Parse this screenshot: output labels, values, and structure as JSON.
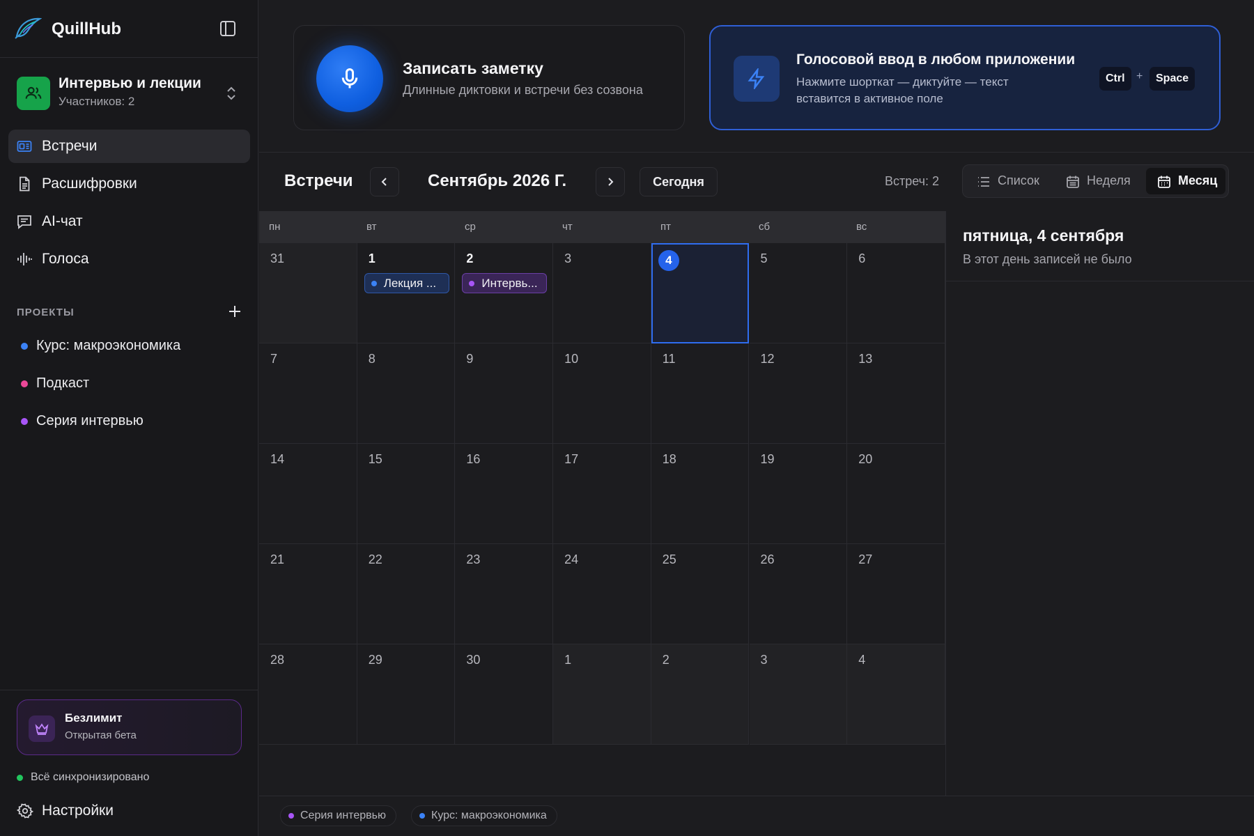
{
  "app": {
    "name": "QuillHub"
  },
  "workspace": {
    "name": "Интервью и лекции",
    "members": "Участников: 2"
  },
  "nav": [
    {
      "label": "Встречи",
      "icon": "meetings-icon",
      "active": true
    },
    {
      "label": "Расшифровки",
      "icon": "document-icon",
      "active": false
    },
    {
      "label": "AI-чат",
      "icon": "chat-icon",
      "active": false
    },
    {
      "label": "Голоса",
      "icon": "waveform-icon",
      "active": false
    }
  ],
  "projects": {
    "title": "ПРОЕКТЫ",
    "items": [
      {
        "label": "Курс: макроэкономика",
        "color": "#3b82f6"
      },
      {
        "label": "Подкаст",
        "color": "#ec4899"
      },
      {
        "label": "Серия интервью",
        "color": "#a855f7"
      }
    ]
  },
  "plan": {
    "title": "Безлимит",
    "subtitle": "Открытая бета"
  },
  "sync": {
    "label": "Всё синхронизировано",
    "color": "#22c55e"
  },
  "settings": {
    "label": "Настройки"
  },
  "record_card": {
    "title": "Записать заметку",
    "subtitle": "Длинные диктовки и встречи без созвона"
  },
  "voice_card": {
    "title": "Голосовой ввод в любом приложении",
    "subtitle": "Нажмите шорткат — диктуйте — текст вставится в активное поле",
    "keys": [
      "Ctrl",
      "Space"
    ],
    "plus": "+"
  },
  "toolbar": {
    "title": "Встречи",
    "month": "Сентябрь 2026 Г.",
    "today": "Сегодня",
    "count": "Встреч: 2",
    "views": [
      {
        "label": "Список",
        "icon": "list-icon",
        "active": false
      },
      {
        "label": "Неделя",
        "icon": "calendar-week-icon",
        "active": false
      },
      {
        "label": "Месяц",
        "icon": "calendar-month-icon",
        "active": true
      }
    ]
  },
  "calendar": {
    "weekdays": [
      "пн",
      "вт",
      "ср",
      "чт",
      "пт",
      "сб",
      "вс"
    ],
    "days": [
      {
        "n": "31",
        "other": true
      },
      {
        "n": "1",
        "cur": true,
        "event": {
          "title": "Лекция ...",
          "color": "blue"
        }
      },
      {
        "n": "2",
        "cur": true,
        "event": {
          "title": "Интервь...",
          "color": "purple"
        }
      },
      {
        "n": "3"
      },
      {
        "n": "4",
        "today": true
      },
      {
        "n": "5"
      },
      {
        "n": "6"
      },
      {
        "n": "7"
      },
      {
        "n": "8"
      },
      {
        "n": "9"
      },
      {
        "n": "10"
      },
      {
        "n": "11"
      },
      {
        "n": "12"
      },
      {
        "n": "13"
      },
      {
        "n": "14"
      },
      {
        "n": "15"
      },
      {
        "n": "16"
      },
      {
        "n": "17"
      },
      {
        "n": "18"
      },
      {
        "n": "19"
      },
      {
        "n": "20"
      },
      {
        "n": "21"
      },
      {
        "n": "22"
      },
      {
        "n": "23"
      },
      {
        "n": "24"
      },
      {
        "n": "25"
      },
      {
        "n": "26"
      },
      {
        "n": "27"
      },
      {
        "n": "28"
      },
      {
        "n": "29"
      },
      {
        "n": "30"
      },
      {
        "n": "1",
        "other": true
      },
      {
        "n": "2",
        "other": true
      },
      {
        "n": "3",
        "other": true
      },
      {
        "n": "4",
        "other": true
      }
    ]
  },
  "detail": {
    "title": "пятница, 4 сентября",
    "subtitle": "В этот день записей не было"
  },
  "legend": [
    {
      "label": "Серия интервью",
      "color": "#a855f7"
    },
    {
      "label": "Курс: макроэкономика",
      "color": "#3b82f6"
    }
  ]
}
